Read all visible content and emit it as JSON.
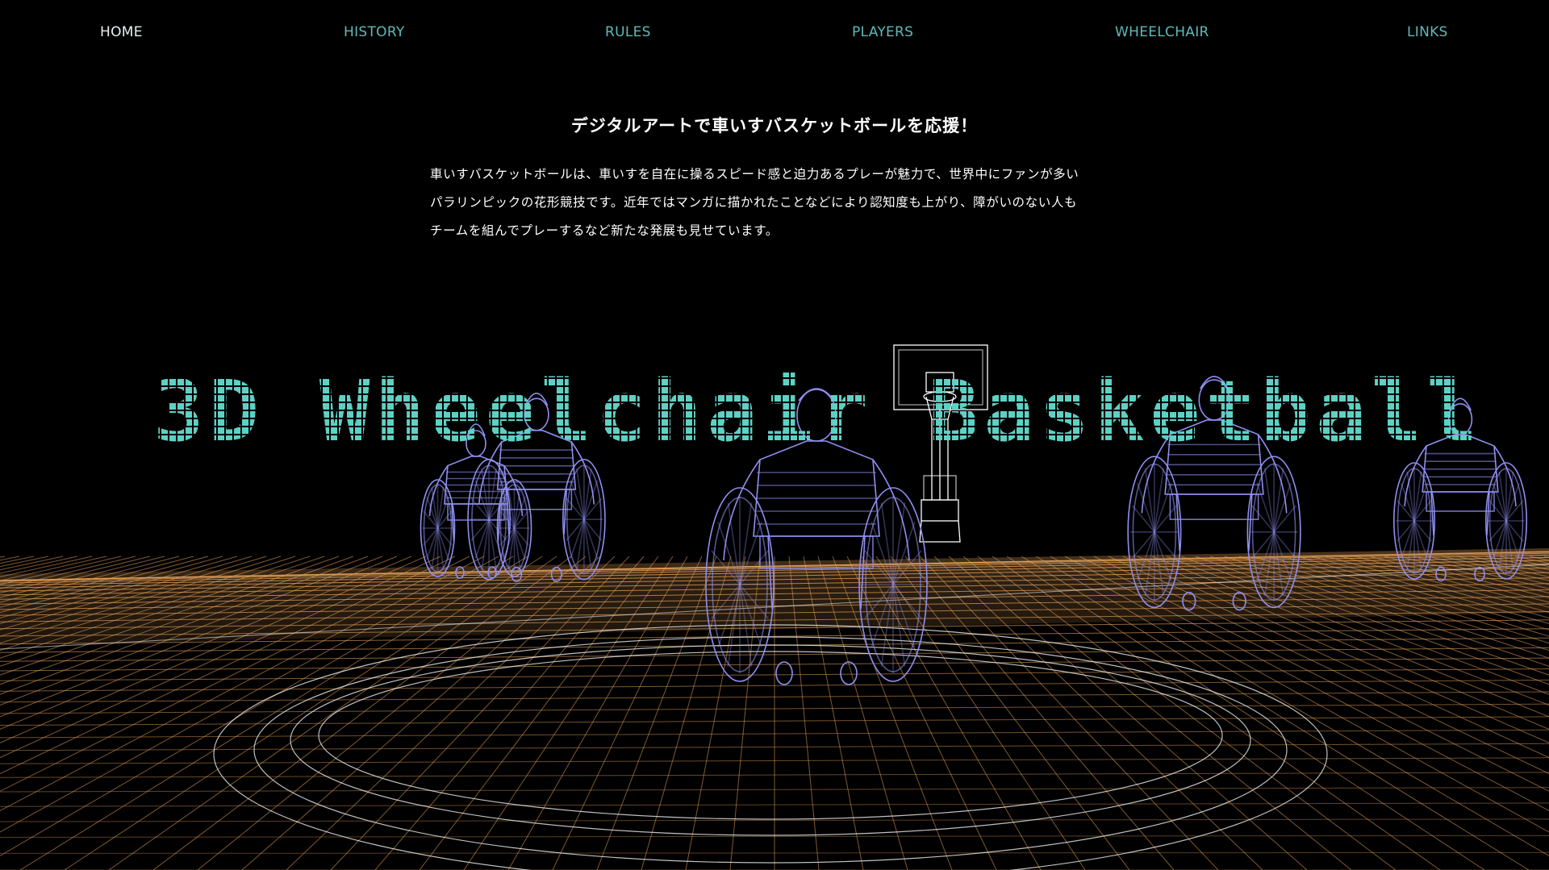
{
  "nav": {
    "items": [
      {
        "label": "HOME",
        "active": true
      },
      {
        "label": "HISTORY",
        "active": false
      },
      {
        "label": "RULES",
        "active": false
      },
      {
        "label": "PLAYERS",
        "active": false
      },
      {
        "label": "WHEELCHAIR",
        "active": false
      },
      {
        "label": "LINKS",
        "active": false
      }
    ]
  },
  "intro": {
    "title": "デジタルアートで車いすバスケットボールを応援！",
    "lines": [
      "車いすバスケットボールは、車いすを自在に操るスピード感と迫力あるプレーが魅力で、世界中にファンが多い",
      "パラリンピックの花形競技です。近年ではマンガに描かれたことなどにより認知度も上がり、障がいのない人も",
      "チームを組んでプレーするなど新たな発展も見せています。"
    ]
  },
  "hero": {
    "title": "3D Wheelchair Basketball"
  },
  "colors": {
    "background": "#000000",
    "nav_link": "#5fb9b8",
    "nav_active": "#e6f1f1",
    "hero_title": "#5fd0c4",
    "wireframe_players": "#8f8ff0",
    "court_grid": "#e8a35a",
    "court_lines": "#ffffff"
  }
}
